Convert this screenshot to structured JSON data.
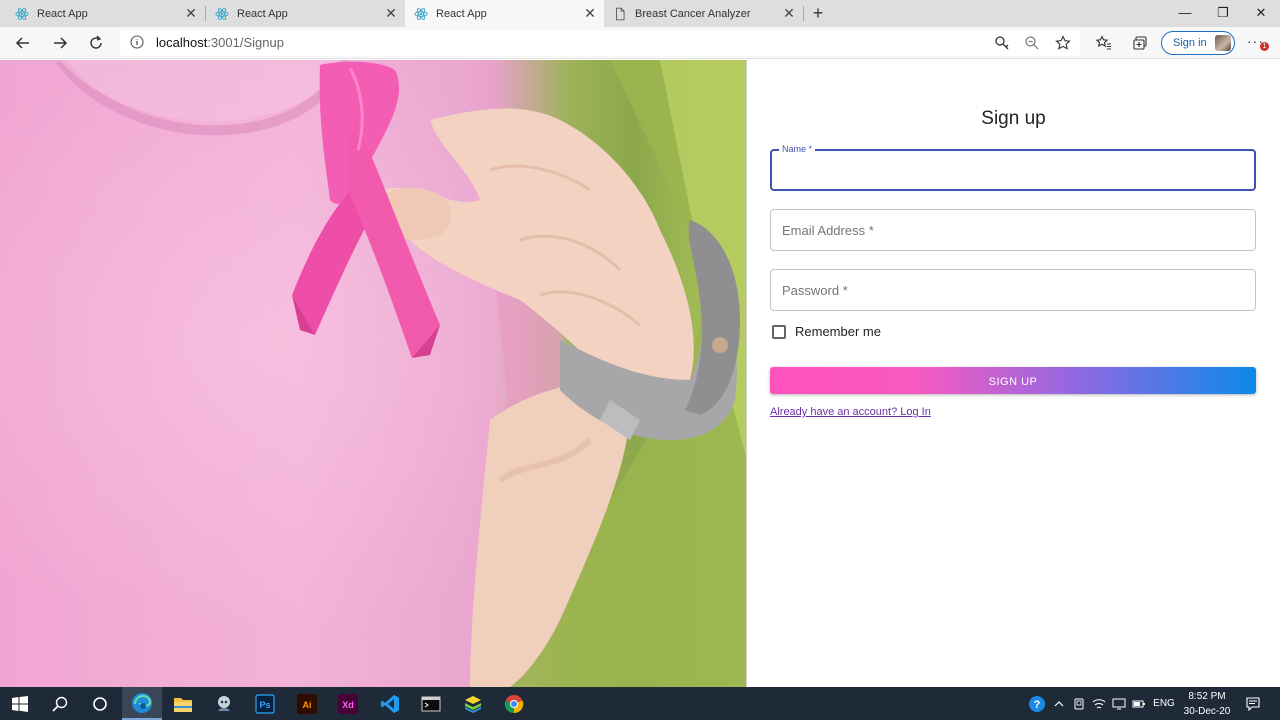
{
  "browser": {
    "tabs": [
      {
        "title": "React App",
        "icon": "react-icon",
        "active": false
      },
      {
        "title": "React App",
        "icon": "react-icon",
        "active": false
      },
      {
        "title": "React App",
        "icon": "react-icon",
        "active": true
      },
      {
        "title": "Breast Cancer Analyzer",
        "icon": "document-icon",
        "active": false
      }
    ],
    "address": {
      "host": "localhost",
      "path": ":3001/Signup"
    },
    "sign_in_label": "Sign in",
    "notification_badge": "1"
  },
  "hero": {
    "image": "pink-ribbon-photo"
  },
  "signup": {
    "title": "Sign up",
    "name_label": "Name *",
    "name_value": "",
    "email_label": "Email Address *",
    "password_label": "Password *",
    "remember_label": "Remember me",
    "remember_checked": false,
    "submit_label": "SIGN UP",
    "login_link": "Already have an account? Log In"
  },
  "taskbar": {
    "apps": [
      "windows-start-icon",
      "search-icon",
      "cortana-icon",
      "edge-icon",
      "file-explorer-icon",
      "app-icon",
      "photoshop-icon",
      "illustrator-icon",
      "xd-icon",
      "vscode-icon",
      "terminal-icon",
      "bluestacks-icon",
      "chrome-icon"
    ],
    "photoshop_label": "Ps",
    "illustrator_label": "Ai",
    "xd_label": "Xd",
    "language": "ENG",
    "time": "8:52 PM",
    "date": "30-Dec-20"
  },
  "colors": {
    "accent": "#3f51b5",
    "button_start": "#fe52bd",
    "button_end": "#0b8ae8",
    "taskbar": "#1f2a38"
  }
}
